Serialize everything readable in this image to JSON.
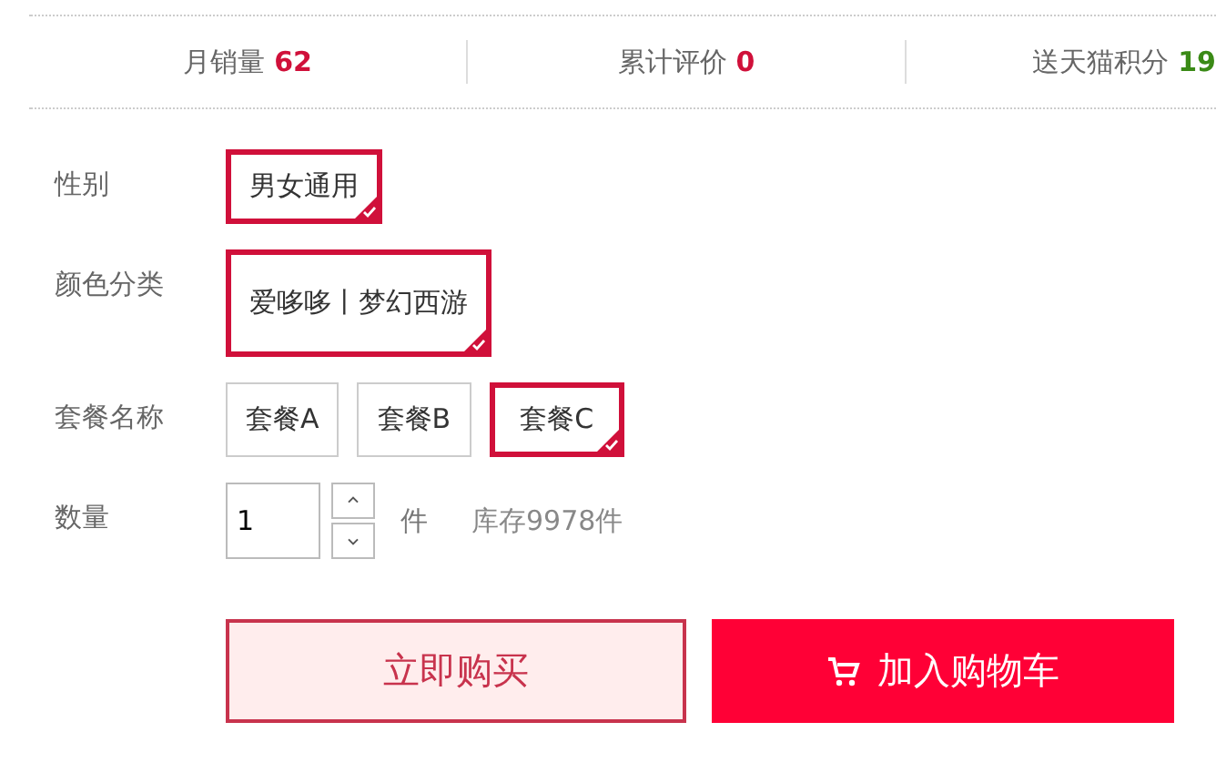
{
  "stats": [
    {
      "label": "月销量",
      "value": "62",
      "color": "#d0103a"
    },
    {
      "label": "累计评价",
      "value": "0",
      "color": "#d0103a"
    },
    {
      "label": "送天猫积分",
      "value": "19",
      "color": "#3a8a16"
    }
  ],
  "properties": [
    {
      "label": "性别",
      "options": [
        {
          "text": "男女通用",
          "selected": true
        }
      ]
    },
    {
      "label": "颜色分类",
      "options": [
        {
          "text": "爱哆哆丨梦幻西游",
          "selected": true
        }
      ]
    },
    {
      "label": "套餐名称",
      "options": [
        {
          "text": "套餐A",
          "selected": false
        },
        {
          "text": "套餐B",
          "selected": false
        },
        {
          "text": "套餐C",
          "selected": true
        }
      ]
    }
  ],
  "quantity": {
    "label": "数量",
    "value": "1",
    "unit": "件",
    "stock": "库存9978件"
  },
  "buttons": [
    {
      "kind": "buy",
      "text": "立即购买"
    },
    {
      "kind": "cart",
      "text": "加入购物车"
    }
  ]
}
